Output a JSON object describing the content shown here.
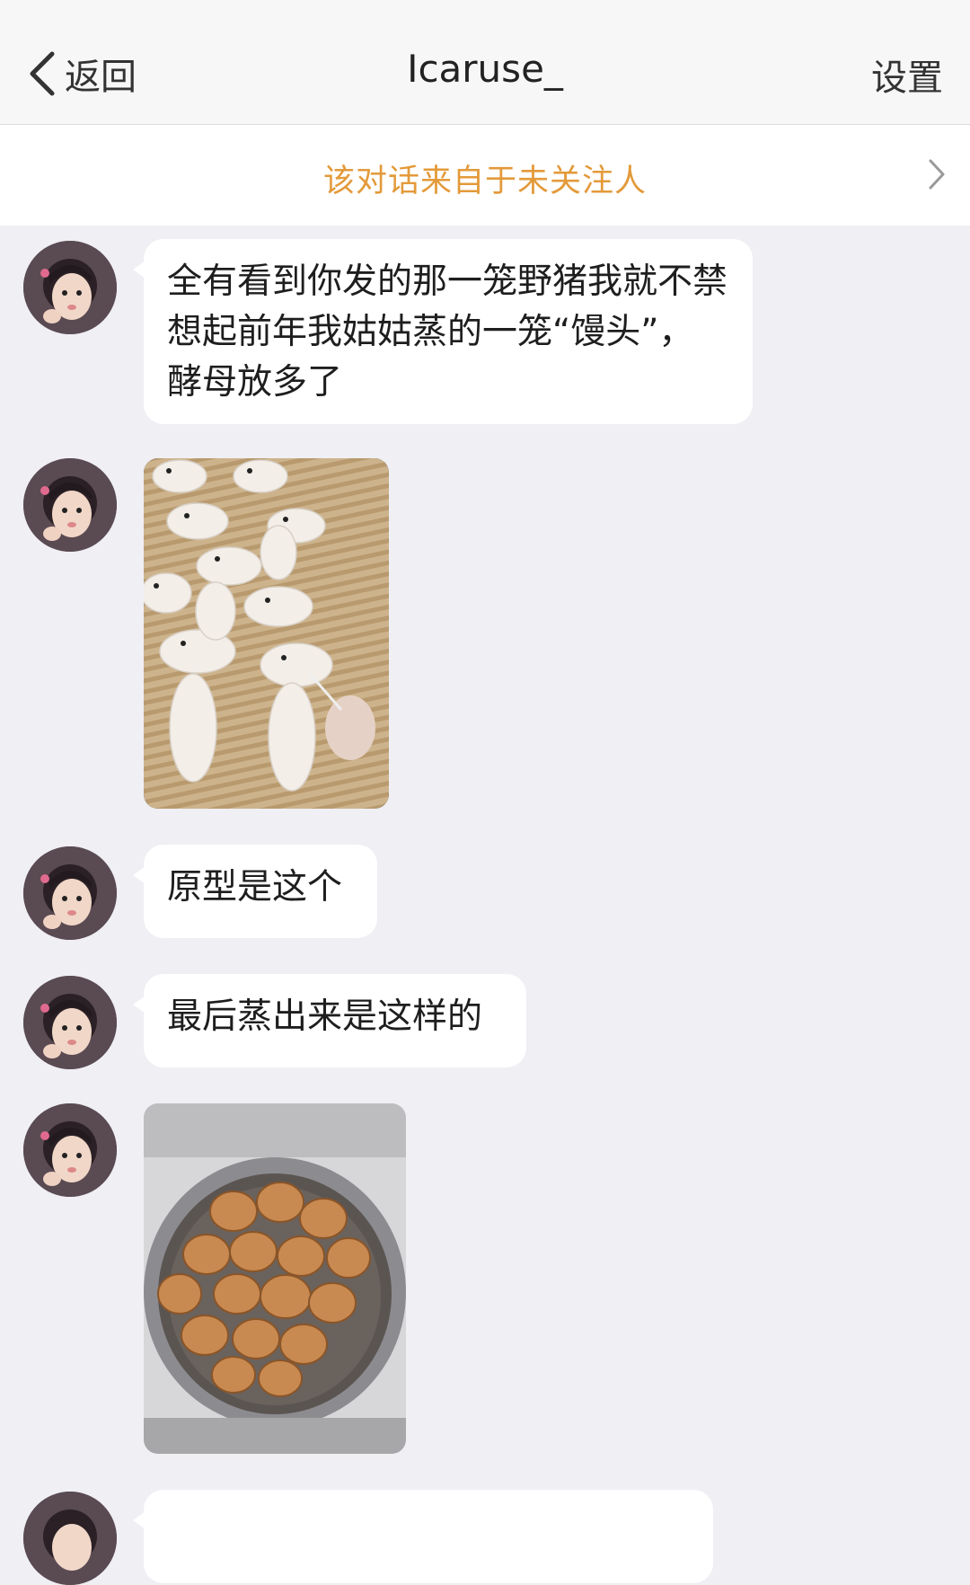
{
  "nav": {
    "back_label": "返回",
    "title": "Icaruse_",
    "settings_label": "设置"
  },
  "notice": {
    "text": "该对话来自于未关注人"
  },
  "messages": [
    {
      "type": "text",
      "text": "全有看到你发的那一笼野猪我就不禁想起前年我姑姑蒸的一笼“馒头”，酵母放多了"
    },
    {
      "type": "image",
      "subject": "unbaked dough shaped like ducks on a bamboo mat"
    },
    {
      "type": "text",
      "text": "原型是这个"
    },
    {
      "type": "text",
      "text": "最后蒸出来是这样的"
    },
    {
      "type": "image",
      "subject": "steamed buns turned brown in a steamer pot"
    },
    {
      "type": "text",
      "text": ""
    }
  ],
  "colors": {
    "background": "#efeff4",
    "notice_text": "#e39a3a",
    "bubble": "#ffffff"
  }
}
